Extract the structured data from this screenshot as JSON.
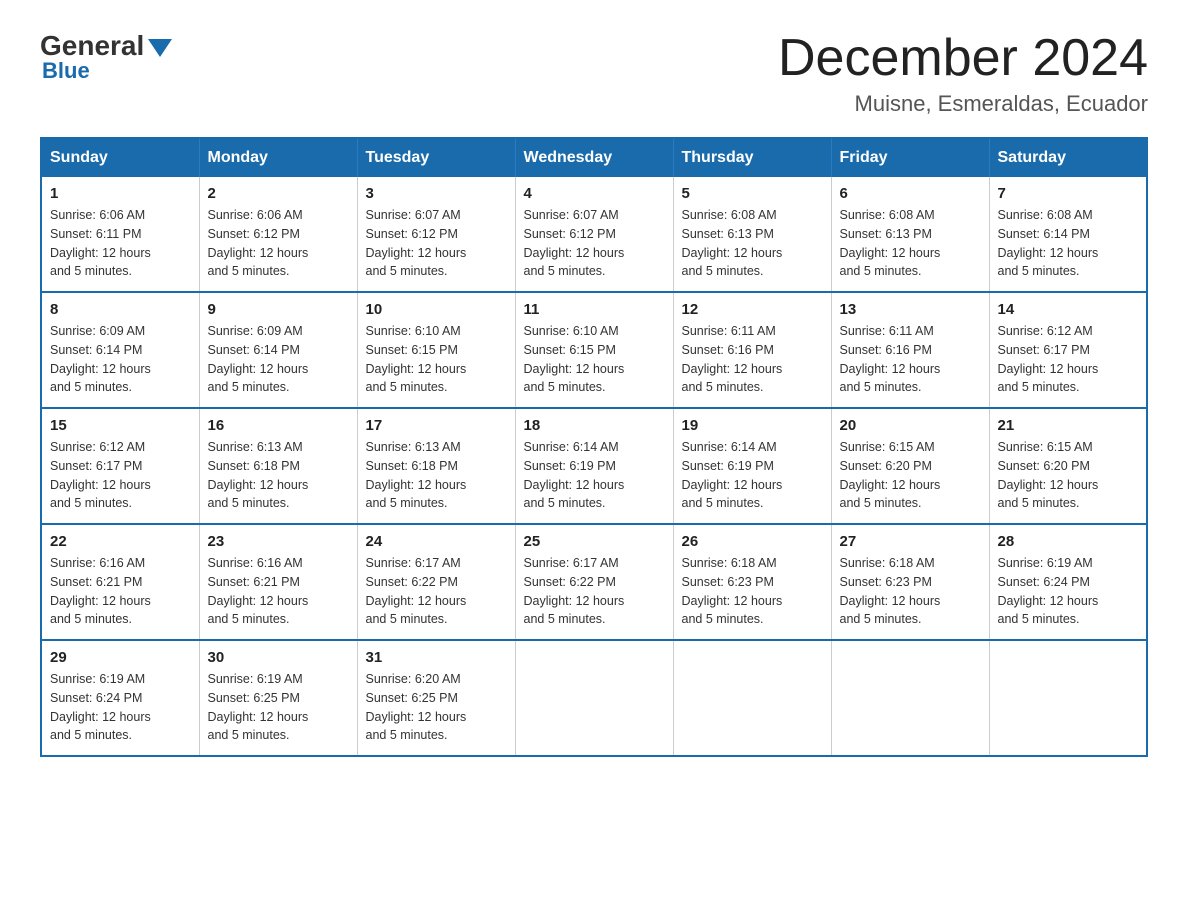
{
  "logo": {
    "general": "General",
    "blue": "Blue"
  },
  "title": "December 2024",
  "location": "Muisne, Esmeraldas, Ecuador",
  "days_of_week": [
    "Sunday",
    "Monday",
    "Tuesday",
    "Wednesday",
    "Thursday",
    "Friday",
    "Saturday"
  ],
  "weeks": [
    [
      {
        "day": "1",
        "sunrise": "6:06 AM",
        "sunset": "6:11 PM",
        "daylight": "12 hours and 5 minutes."
      },
      {
        "day": "2",
        "sunrise": "6:06 AM",
        "sunset": "6:12 PM",
        "daylight": "12 hours and 5 minutes."
      },
      {
        "day": "3",
        "sunrise": "6:07 AM",
        "sunset": "6:12 PM",
        "daylight": "12 hours and 5 minutes."
      },
      {
        "day": "4",
        "sunrise": "6:07 AM",
        "sunset": "6:12 PM",
        "daylight": "12 hours and 5 minutes."
      },
      {
        "day": "5",
        "sunrise": "6:08 AM",
        "sunset": "6:13 PM",
        "daylight": "12 hours and 5 minutes."
      },
      {
        "day": "6",
        "sunrise": "6:08 AM",
        "sunset": "6:13 PM",
        "daylight": "12 hours and 5 minutes."
      },
      {
        "day": "7",
        "sunrise": "6:08 AM",
        "sunset": "6:14 PM",
        "daylight": "12 hours and 5 minutes."
      }
    ],
    [
      {
        "day": "8",
        "sunrise": "6:09 AM",
        "sunset": "6:14 PM",
        "daylight": "12 hours and 5 minutes."
      },
      {
        "day": "9",
        "sunrise": "6:09 AM",
        "sunset": "6:14 PM",
        "daylight": "12 hours and 5 minutes."
      },
      {
        "day": "10",
        "sunrise": "6:10 AM",
        "sunset": "6:15 PM",
        "daylight": "12 hours and 5 minutes."
      },
      {
        "day": "11",
        "sunrise": "6:10 AM",
        "sunset": "6:15 PM",
        "daylight": "12 hours and 5 minutes."
      },
      {
        "day": "12",
        "sunrise": "6:11 AM",
        "sunset": "6:16 PM",
        "daylight": "12 hours and 5 minutes."
      },
      {
        "day": "13",
        "sunrise": "6:11 AM",
        "sunset": "6:16 PM",
        "daylight": "12 hours and 5 minutes."
      },
      {
        "day": "14",
        "sunrise": "6:12 AM",
        "sunset": "6:17 PM",
        "daylight": "12 hours and 5 minutes."
      }
    ],
    [
      {
        "day": "15",
        "sunrise": "6:12 AM",
        "sunset": "6:17 PM",
        "daylight": "12 hours and 5 minutes."
      },
      {
        "day": "16",
        "sunrise": "6:13 AM",
        "sunset": "6:18 PM",
        "daylight": "12 hours and 5 minutes."
      },
      {
        "day": "17",
        "sunrise": "6:13 AM",
        "sunset": "6:18 PM",
        "daylight": "12 hours and 5 minutes."
      },
      {
        "day": "18",
        "sunrise": "6:14 AM",
        "sunset": "6:19 PM",
        "daylight": "12 hours and 5 minutes."
      },
      {
        "day": "19",
        "sunrise": "6:14 AM",
        "sunset": "6:19 PM",
        "daylight": "12 hours and 5 minutes."
      },
      {
        "day": "20",
        "sunrise": "6:15 AM",
        "sunset": "6:20 PM",
        "daylight": "12 hours and 5 minutes."
      },
      {
        "day": "21",
        "sunrise": "6:15 AM",
        "sunset": "6:20 PM",
        "daylight": "12 hours and 5 minutes."
      }
    ],
    [
      {
        "day": "22",
        "sunrise": "6:16 AM",
        "sunset": "6:21 PM",
        "daylight": "12 hours and 5 minutes."
      },
      {
        "day": "23",
        "sunrise": "6:16 AM",
        "sunset": "6:21 PM",
        "daylight": "12 hours and 5 minutes."
      },
      {
        "day": "24",
        "sunrise": "6:17 AM",
        "sunset": "6:22 PM",
        "daylight": "12 hours and 5 minutes."
      },
      {
        "day": "25",
        "sunrise": "6:17 AM",
        "sunset": "6:22 PM",
        "daylight": "12 hours and 5 minutes."
      },
      {
        "day": "26",
        "sunrise": "6:18 AM",
        "sunset": "6:23 PM",
        "daylight": "12 hours and 5 minutes."
      },
      {
        "day": "27",
        "sunrise": "6:18 AM",
        "sunset": "6:23 PM",
        "daylight": "12 hours and 5 minutes."
      },
      {
        "day": "28",
        "sunrise": "6:19 AM",
        "sunset": "6:24 PM",
        "daylight": "12 hours and 5 minutes."
      }
    ],
    [
      {
        "day": "29",
        "sunrise": "6:19 AM",
        "sunset": "6:24 PM",
        "daylight": "12 hours and 5 minutes."
      },
      {
        "day": "30",
        "sunrise": "6:19 AM",
        "sunset": "6:25 PM",
        "daylight": "12 hours and 5 minutes."
      },
      {
        "day": "31",
        "sunrise": "6:20 AM",
        "sunset": "6:25 PM",
        "daylight": "12 hours and 5 minutes."
      },
      null,
      null,
      null,
      null
    ]
  ],
  "labels": {
    "sunrise": "Sunrise:",
    "sunset": "Sunset:",
    "daylight": "Daylight: 12 hours"
  }
}
